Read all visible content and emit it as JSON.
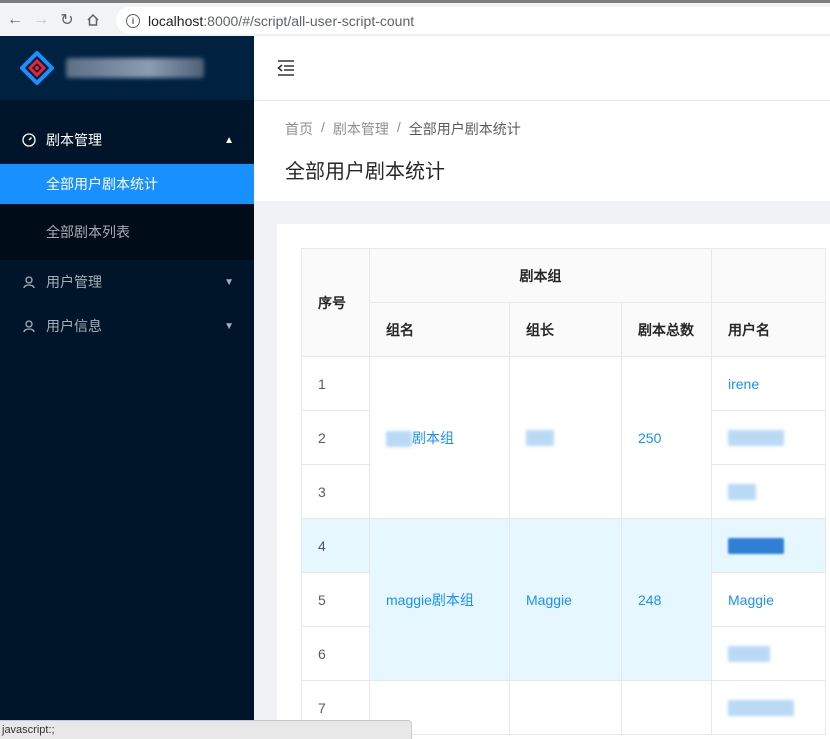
{
  "browser": {
    "url_host": "localhost",
    "url_path": ":8000/#/script/all-user-script-count"
  },
  "sidebar": {
    "menu_group": {
      "label": "剧本管理",
      "items": [
        {
          "label": "全部用户剧本统计"
        },
        {
          "label": "全部剧本列表"
        }
      ]
    },
    "items": [
      {
        "label": "用户管理"
      },
      {
        "label": "用户信息"
      }
    ]
  },
  "breadcrumb": [
    "首页",
    "剧本管理",
    "全部用户剧本统计"
  ],
  "page_title": "全部用户剧本统计",
  "table": {
    "headers": {
      "index": "序号",
      "group": "剧本组",
      "group_name": "组名",
      "leader": "组长",
      "script_total": "剧本总数",
      "username": "用户名"
    },
    "rows": [
      {
        "index": "1",
        "username": "irene"
      },
      {
        "index": "2",
        "username": ""
      },
      {
        "index": "3",
        "username": ""
      },
      {
        "index": "4",
        "username": ""
      },
      {
        "index": "5",
        "username": "Maggie"
      },
      {
        "index": "6",
        "username": ""
      },
      {
        "index": "7",
        "username": ""
      }
    ],
    "groups": [
      {
        "name": "剧本组",
        "leader": "",
        "total": "250"
      },
      {
        "name": "maggie剧本组",
        "leader": "Maggie",
        "total": "248"
      }
    ]
  },
  "status_bar": "javascript:;",
  "colors": {
    "sidebar_bg": "#001529",
    "primary": "#1890ff",
    "highlight_row": "#e6f7ff"
  }
}
